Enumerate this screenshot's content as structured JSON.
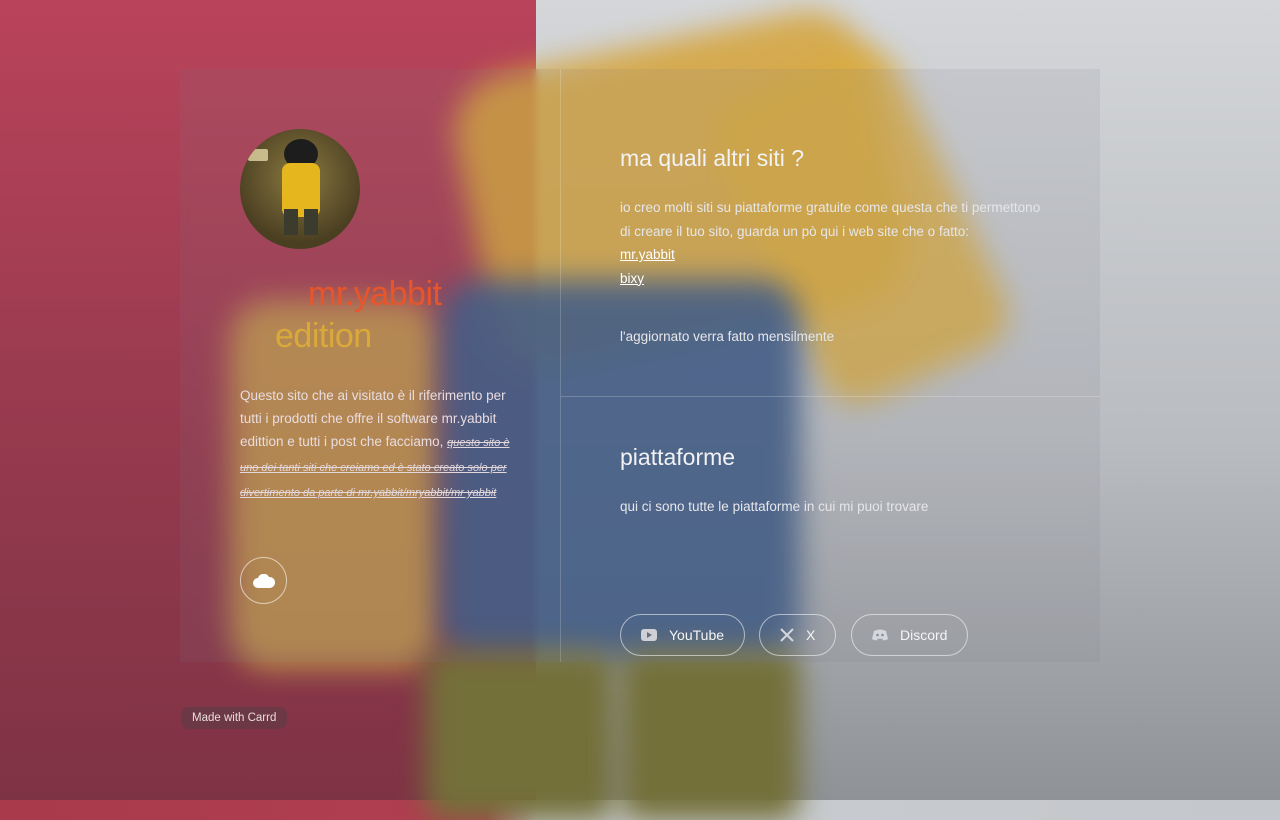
{
  "profile": {
    "title_line1": "mr.yabbit",
    "title_line2": "edition",
    "description": "Questo sito che ai visitato è il riferimento per tutti i prodotti che offre il software mr.yabbit edittion e tutti i post che facciamo,",
    "struck_note": "questo sito è uno dei tanti siti che creiamo ed è stato creato solo per divertimento da parte di mr.yabbit/mryabbit/mr yabbit",
    "cloud_icon": "cloud-icon"
  },
  "sites": {
    "heading": "ma quali altri siti ?",
    "intro": "io creo molti siti su piattaforme gratuite come questa che ti permettono di creare il tuo sito, guarda un pò qui i web site che o fatto:",
    "links": [
      "mr.yabbit",
      "bixy"
    ],
    "footer_note": "l'aggiornato verra fatto mensilmente"
  },
  "platforms": {
    "heading": "piattaforme",
    "intro": "qui ci sono tutte le piattaforme in cui mi puoi trovare",
    "buttons": [
      {
        "label": "YouTube",
        "icon": "youtube-icon"
      },
      {
        "label": "X",
        "icon": "x-icon"
      },
      {
        "label": "Discord",
        "icon": "discord-icon"
      }
    ]
  },
  "badge": "Made with Carrd",
  "colors": {
    "title1": "#e8552a",
    "title2": "#d9a93a"
  }
}
